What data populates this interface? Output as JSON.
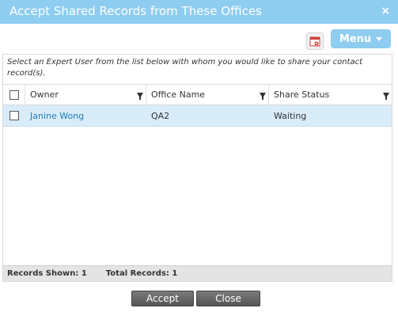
{
  "dialog": {
    "title": "Accept Shared Records from These Offices",
    "close_label": "×"
  },
  "toolbar": {
    "menu_label": "Menu",
    "export_icon": "calendar-gear-icon"
  },
  "grid": {
    "instructions": "Select an Expert User from the list below with whom you would like to share your contact record(s).",
    "columns": [
      "Owner",
      "Office Name",
      "Share Status"
    ],
    "rows": [
      {
        "owner": "Janine Wong",
        "office_name": "QA2",
        "share_status": "Waiting"
      }
    ],
    "footer": {
      "records_shown": "Records Shown: 1",
      "total_records": "Total Records: 1"
    }
  },
  "actions": {
    "accept_label": "Accept",
    "close_label": "Close"
  },
  "colors": {
    "accent": "#8ecdf0",
    "link": "#1f7db8",
    "row_selected": "#d9ecfa"
  }
}
